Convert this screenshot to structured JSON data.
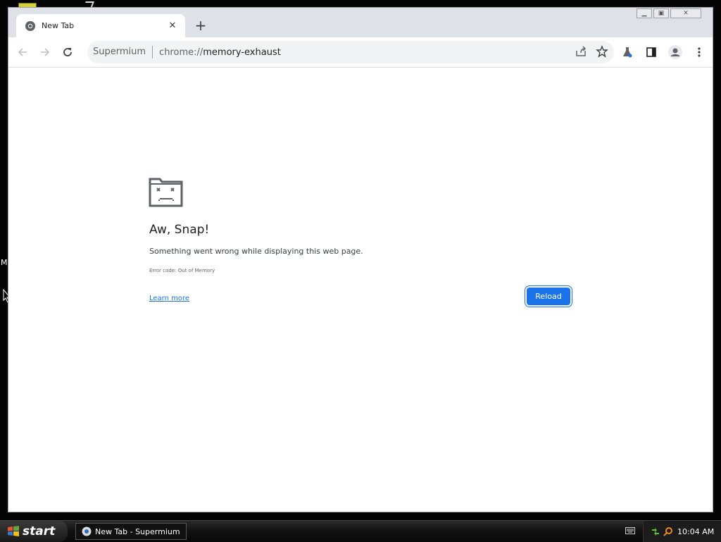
{
  "desktop": {
    "side_letter": "M"
  },
  "browser": {
    "tab": {
      "title": "New Tab"
    },
    "omnibox": {
      "chip": "Supermium",
      "url_scheme": "chrome://",
      "url_host": "memory-exhaust"
    }
  },
  "error_page": {
    "heading": "Aw, Snap!",
    "message": "Something went wrong while displaying this web page.",
    "error_code": "Error code: Out of Memory",
    "learn_more": "Learn more",
    "reload_label": "Reload"
  },
  "taskbar": {
    "start_label": "start",
    "task_item": "New Tab - Supermium",
    "clock": "10:04 AM"
  },
  "colors": {
    "accent": "#1a73e8",
    "tab_strip": "#dee1e6"
  }
}
